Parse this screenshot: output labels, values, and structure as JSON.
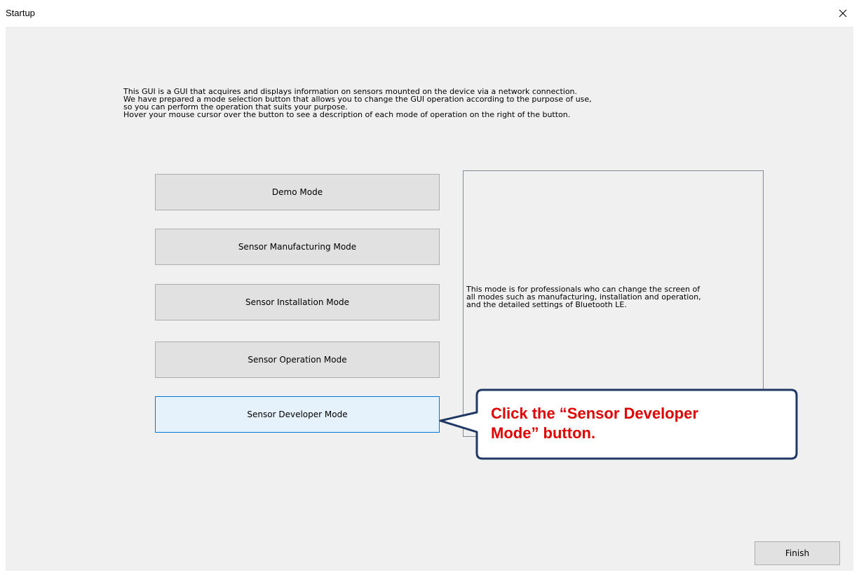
{
  "window": {
    "title": "Startup",
    "close_icon": "close-icon"
  },
  "intro": {
    "lines": [
      "This GUI is a GUI that acquires and displays information on sensors mounted on the device via a network connection.",
      "We have prepared a mode selection button that allows you to change the GUI operation according to the purpose of use,",
      "so you can perform the operation that suits your purpose.",
      "Hover your mouse cursor over the button to see a description of each mode of operation on the right of the button."
    ]
  },
  "modes": [
    {
      "label": "Demo Mode",
      "state": "normal"
    },
    {
      "label": "Sensor Manufacturing Mode",
      "state": "normal"
    },
    {
      "label": "Sensor Installation Mode",
      "state": "normal"
    },
    {
      "label": "Sensor Operation Mode",
      "state": "normal"
    },
    {
      "label": "Sensor Developer Mode",
      "state": "hover"
    }
  ],
  "description": {
    "lines": [
      "This mode is for professionals who can change the screen of",
      "all modes such as manufacturing, installation and operation,",
      "and the detailed settings of Bluetooth LE."
    ]
  },
  "finish_label": "Finish",
  "callout": {
    "line1": "Click the “Sensor Developer",
    "line2": "Mode” button.",
    "text_color": "#e00000",
    "border_color": "#1f3864"
  },
  "colors": {
    "client_bg": "#f0f0f0",
    "button_bg": "#e1e1e1",
    "button_hover_bg": "#e5f1fb",
    "button_hover_border": "#0078d7"
  }
}
